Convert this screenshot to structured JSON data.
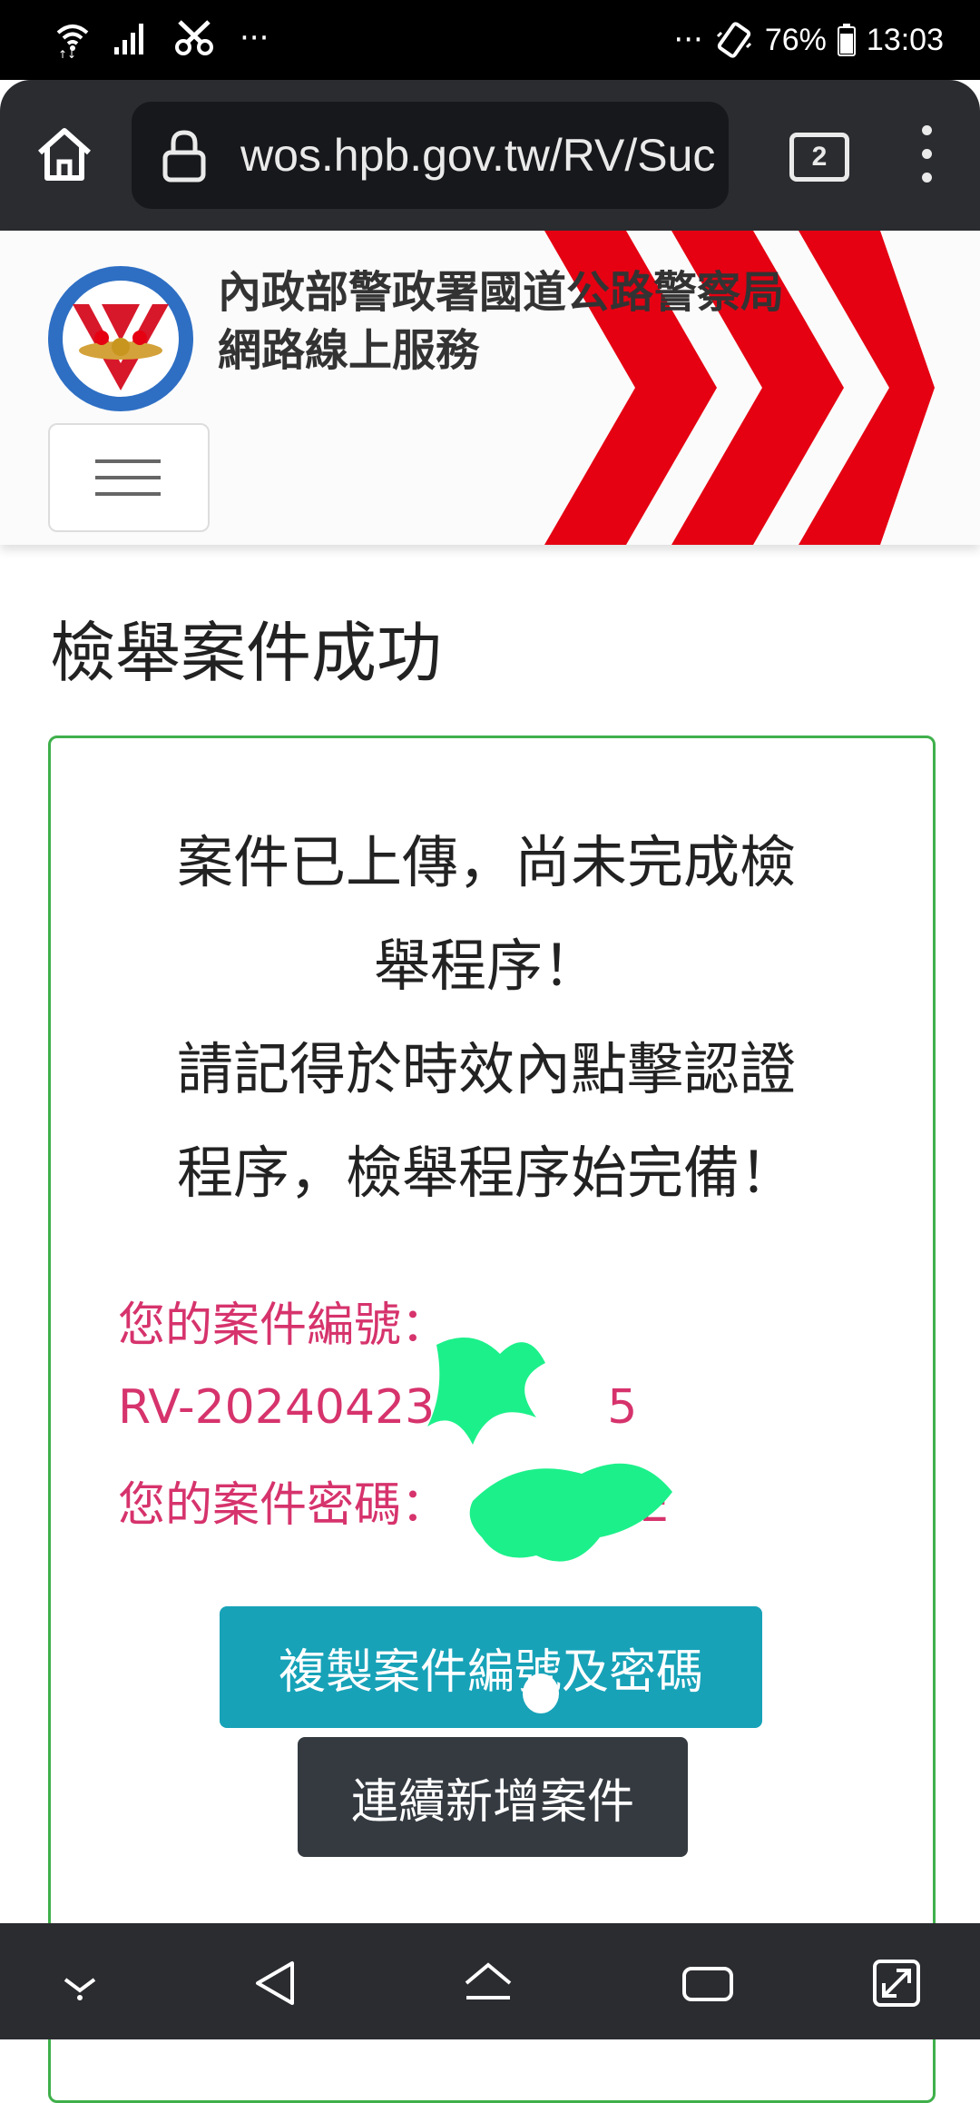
{
  "status_bar": {
    "battery": "76%",
    "time": "13:03",
    "left_more": "···",
    "right_more": "···"
  },
  "browser": {
    "url": "wos.hpb.gov.tw/RV/Suc",
    "tab_count": "2"
  },
  "site": {
    "title_line1": "內政部警政署國道公路警察局",
    "title_line2": "網路線上服務"
  },
  "page": {
    "heading": "檢舉案件成功",
    "notice_line1": "案件已上傳，尚未完成檢",
    "notice_line2": "舉程序！",
    "notice_line3": "請記得於時效內點擊認證",
    "notice_line4": "程序，檢舉程序始完備！",
    "case_number_label": "您的案件編號：",
    "case_number_value": "RV-20240423",
    "case_number_suffix": "5",
    "case_password_label": "您的案件密碼：",
    "case_password_suffix": "E",
    "copy_button": "複製案件編號及密碼",
    "new_case_button": "連續新增案件"
  },
  "colors": {
    "accent_red": "#e50012",
    "success_border": "#3fb04b",
    "label_pink": "#d6336c",
    "button_info": "#17a2b8",
    "button_dark": "#343a40",
    "redaction_green": "#1cf08a"
  },
  "icons": {
    "status": [
      "wifi-icon",
      "signal-icon",
      "scissors-icon",
      "vibrate-icon",
      "battery-icon"
    ],
    "toolbar": [
      "home-icon",
      "lock-icon",
      "tab-switcher-icon",
      "more-menu-icon"
    ],
    "navbar": [
      "hide-navbar-icon",
      "back-icon",
      "home-icon",
      "recents-icon",
      "expand-icon"
    ]
  }
}
